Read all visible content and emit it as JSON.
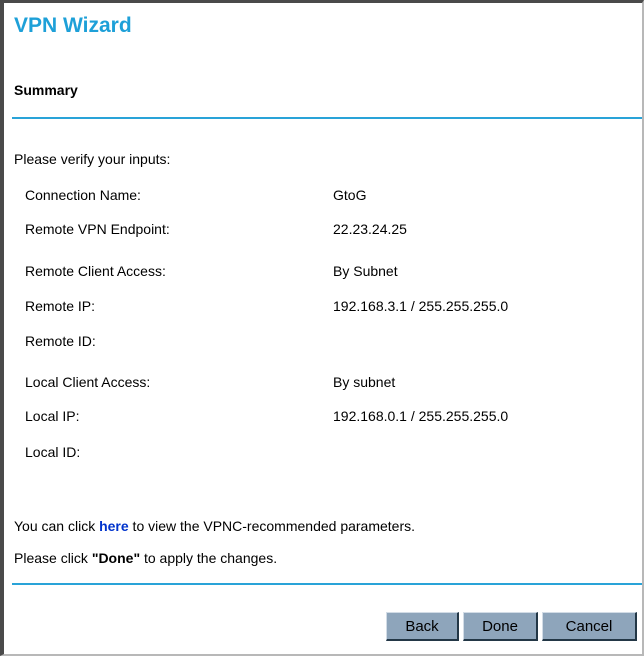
{
  "wizard": {
    "title": "VPN Wizard",
    "section_heading": "Summary",
    "intro": "Please verify your inputs:"
  },
  "summary": {
    "connection_name_label": "Connection Name:",
    "connection_name_value": "GtoG",
    "remote_vpn_endpoint_label": "Remote VPN Endpoint:",
    "remote_vpn_endpoint_value": "22.23.24.25",
    "remote_client_access_label": "Remote Client Access:",
    "remote_client_access_value": "By Subnet",
    "remote_ip_label": "Remote IP:",
    "remote_ip_value": "192.168.3.1 / 255.255.255.0",
    "remote_id_label": "Remote ID:",
    "local_client_access_label": "Local Client Access:",
    "local_client_access_value": "By subnet",
    "local_ip_label": "Local IP:",
    "local_ip_value": "192.168.0.1 / 255.255.255.0",
    "local_id_label": "Local ID:"
  },
  "notes": {
    "click_prefix": "You can click ",
    "here_link": "here",
    "click_suffix": " to view the VPNC-recommended parameters.",
    "done_prefix": "Please click ",
    "done_bold": "\"Done\"",
    "done_suffix": " to apply the changes."
  },
  "buttons": {
    "back": "Back",
    "done": "Done",
    "cancel": "Cancel"
  },
  "colors": {
    "title": "#1ea0d8",
    "rule": "#29a3d8",
    "link": "#0033cc",
    "button": "#8ea5bb"
  }
}
